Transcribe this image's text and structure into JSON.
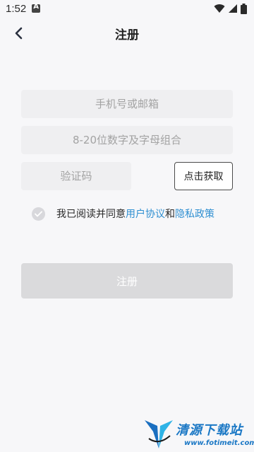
{
  "status_bar": {
    "time": "1:52"
  },
  "nav": {
    "title": "注册"
  },
  "form": {
    "account_placeholder": "手机号或邮箱",
    "password_placeholder": "8-20位数字及字母组合",
    "code_placeholder": "验证码",
    "get_code_label": "点击获取"
  },
  "agreement": {
    "prefix": "我已阅读并同意",
    "user_agreement": "用户协议",
    "and": "和",
    "privacy_policy": "隐私政策",
    "checked": false
  },
  "submit_label": "注册",
  "watermark": {
    "title": "清源下载站",
    "url": "www.fotimeit.com"
  },
  "colors": {
    "link": "#2f8fd1",
    "field_bg": "#efeff1",
    "button_disabled": "#dadadc"
  }
}
